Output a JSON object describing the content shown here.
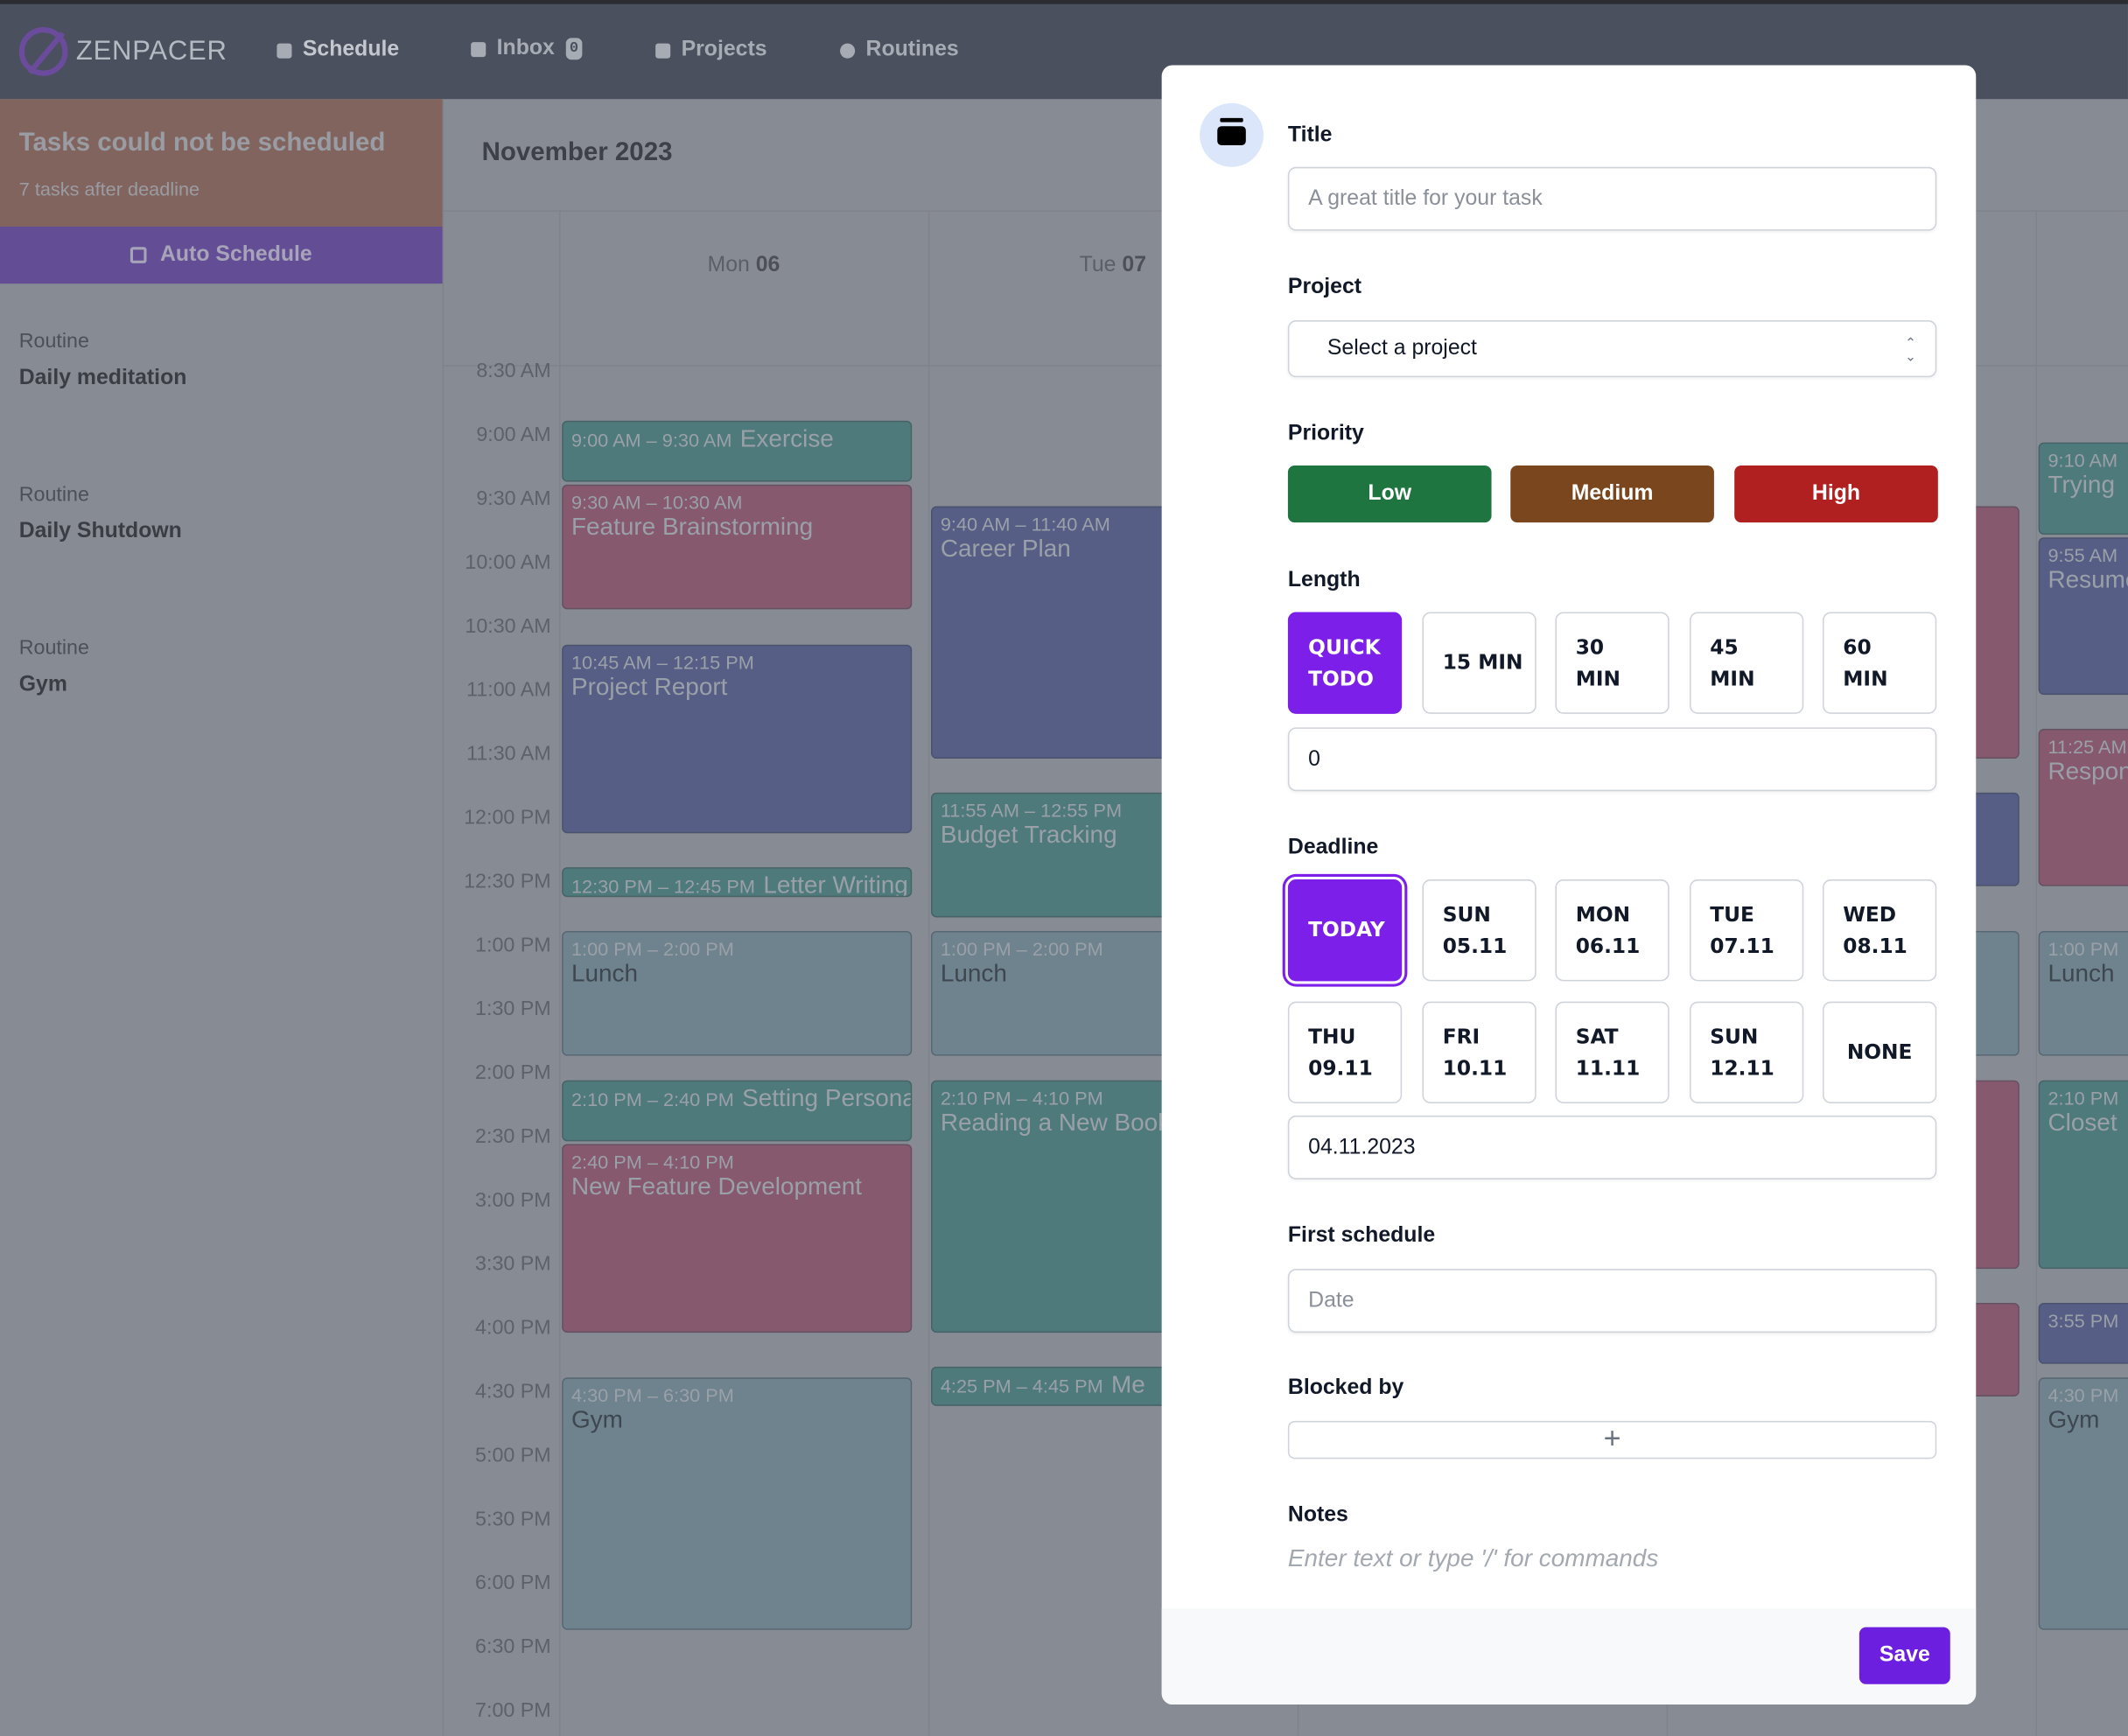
{
  "nav": {
    "logo": "ZENPACER",
    "items": [
      {
        "label": "Schedule",
        "icon": "calendar-icon",
        "active": true
      },
      {
        "label": "Inbox",
        "icon": "inbox-icon",
        "badge": "0"
      },
      {
        "label": "Projects",
        "icon": "folder-icon"
      },
      {
        "label": "Routines",
        "icon": "clock-icon"
      }
    ]
  },
  "sidebar": {
    "alert_title": "Tasks could not be scheduled",
    "alert_sub": "7 tasks after deadline",
    "auto_schedule": "Auto Schedule",
    "routines": [
      {
        "kind": "Routine",
        "name": "Daily meditation"
      },
      {
        "kind": "Routine",
        "name": "Daily Shutdown"
      },
      {
        "kind": "Routine",
        "name": "Gym"
      }
    ]
  },
  "calendar": {
    "month": "November 2023",
    "days": [
      {
        "dow": "Mon",
        "date": "06"
      },
      {
        "dow": "Tue",
        "date": "07"
      }
    ],
    "time_labels": [
      "8:30 AM",
      "9:00 AM",
      "9:30 AM",
      "10:00 AM",
      "10:30 AM",
      "11:00 AM",
      "11:30 AM",
      "12:00 PM",
      "12:30 PM",
      "1:00 PM",
      "1:30 PM",
      "2:00 PM",
      "2:30 PM",
      "3:00 PM",
      "3:30 PM",
      "4:00 PM",
      "4:30 PM",
      "5:00 PM",
      "5:30 PM",
      "6:00 PM",
      "6:30 PM",
      "7:00 PM"
    ],
    "colors": {
      "teal": "#4f7a7c",
      "pink": "#87596f",
      "blue": "#565e86",
      "slate": "#6f838e"
    },
    "events": [
      {
        "day": 0,
        "start": "9:00 AM",
        "end": "9:30 AM",
        "title": "Exercise",
        "color": "teal"
      },
      {
        "day": 0,
        "start": "9:30 AM",
        "end": "10:30 AM",
        "title": "Feature Brainstorming",
        "color": "pink"
      },
      {
        "day": 0,
        "start": "10:45 AM",
        "end": "12:15 PM",
        "title": "Project Report",
        "color": "blue"
      },
      {
        "day": 0,
        "start": "12:30 PM",
        "end": "12:45 PM",
        "title": "Letter Writing",
        "color": "teal"
      },
      {
        "day": 0,
        "start": "1:00 PM",
        "end": "2:00 PM",
        "title": "Lunch",
        "color": "slate"
      },
      {
        "day": 0,
        "start": "2:10 PM",
        "end": "2:40 PM",
        "title": "Setting Personal Goals",
        "color": "teal"
      },
      {
        "day": 0,
        "start": "2:40 PM",
        "end": "4:10 PM",
        "title": "New Feature Development",
        "color": "pink"
      },
      {
        "day": 0,
        "start": "4:30 PM",
        "end": "6:30 PM",
        "title": "Gym",
        "color": "slate"
      },
      {
        "day": 1,
        "start": "9:40 AM",
        "end": "11:40 AM",
        "title": "Career Plan",
        "color": "blue"
      },
      {
        "day": 1,
        "start": "11:55 AM",
        "end": "12:55 PM",
        "title": "Budget Tracking",
        "color": "teal"
      },
      {
        "day": 1,
        "start": "1:00 PM",
        "end": "2:00 PM",
        "title": "Lunch",
        "color": "slate"
      },
      {
        "day": 1,
        "start": "2:10 PM",
        "end": "4:10 PM",
        "title": "Reading a New Book",
        "color": "teal"
      },
      {
        "day": 1,
        "start": "4:25 PM",
        "end": "4:45 PM",
        "title": "Me",
        "color": "teal"
      },
      {
        "day": 3,
        "start": "9:40 AM",
        "end": "11:40 AM",
        "title": "",
        "color": "pink"
      },
      {
        "day": 3,
        "start": "11:55 AM",
        "end": "12:40 PM",
        "title": "",
        "color": "blue"
      },
      {
        "day": 3,
        "start": "1:00 PM",
        "end": "2:00 PM",
        "title": "",
        "color": "slate"
      },
      {
        "day": 3,
        "start": "2:10 PM",
        "end": "3:40 PM",
        "title": "",
        "color": "pink"
      },
      {
        "day": 3,
        "start": "3:55 PM",
        "end": "4:40 PM",
        "title": "",
        "color": "pink"
      },
      {
        "day": 4,
        "start": "9:10 AM",
        "end": "9:55 AM",
        "title": "Trying",
        "color": "teal",
        "time_only_start": true
      },
      {
        "day": 4,
        "start": "9:55 AM",
        "end": "11:10 AM",
        "title": "Resume",
        "color": "blue",
        "time_only_start": true
      },
      {
        "day": 4,
        "start": "11:25 AM",
        "end": "12:40 PM",
        "title": "Respond",
        "color": "pink",
        "time_only_start": true
      },
      {
        "day": 4,
        "start": "1:00 PM",
        "end": "2:00 PM",
        "title": "Lunch",
        "color": "slate",
        "time_only_start": true
      },
      {
        "day": 4,
        "start": "2:10 PM",
        "end": "3:40 PM",
        "title": "Closet",
        "color": "teal",
        "time_only_start": true
      },
      {
        "day": 4,
        "start": "3:55 PM",
        "end": "4:25 PM",
        "title": "",
        "color": "blue",
        "time_only_start": true
      },
      {
        "day": 4,
        "start": "4:30 PM",
        "end": "6:30 PM",
        "title": "Gym",
        "color": "slate",
        "time_only_start": true
      }
    ]
  },
  "modal": {
    "icon": "jar-icon",
    "title_label": "Title",
    "title_placeholder": "A great title for your task",
    "project_label": "Project",
    "project_value": "Select a project",
    "priority_label": "Priority",
    "priorities": [
      {
        "label": "Low",
        "color": "#1e753f"
      },
      {
        "label": "Medium",
        "color": "#7a461d"
      },
      {
        "label": "High",
        "color": "#b02020"
      }
    ],
    "length_label": "Length",
    "lengths": [
      {
        "l1": "QUICK",
        "l2": "TODO",
        "selected": true
      },
      {
        "l1": "15 MIN",
        "l2": ""
      },
      {
        "l1": "30",
        "l2": "MIN"
      },
      {
        "l1": "45",
        "l2": "MIN"
      },
      {
        "l1": "60",
        "l2": "MIN"
      }
    ],
    "length_value": "0",
    "deadline_label": "Deadline",
    "deadlines": [
      {
        "l1": "TODAY",
        "l2": "",
        "selected": true
      },
      {
        "l1": "SUN",
        "l2": "05.11"
      },
      {
        "l1": "MON",
        "l2": "06.11"
      },
      {
        "l1": "TUE",
        "l2": "07.11"
      },
      {
        "l1": "WED",
        "l2": "08.11"
      },
      {
        "l1": "THU",
        "l2": "09.11"
      },
      {
        "l1": "FRI",
        "l2": "10.11"
      },
      {
        "l1": "SAT",
        "l2": "11.11"
      },
      {
        "l1": "SUN",
        "l2": "12.11"
      },
      {
        "l1": "NONE",
        "l2": ""
      }
    ],
    "deadline_value": "04.11.2023",
    "first_schedule_label": "First schedule",
    "first_schedule_placeholder": "Date",
    "blocked_by_label": "Blocked by",
    "blocked_by_add": "+",
    "notes_label": "Notes",
    "notes_placeholder": "Enter text or type '/' for commands",
    "save": "Save",
    "accent": "#7c1fe8"
  }
}
